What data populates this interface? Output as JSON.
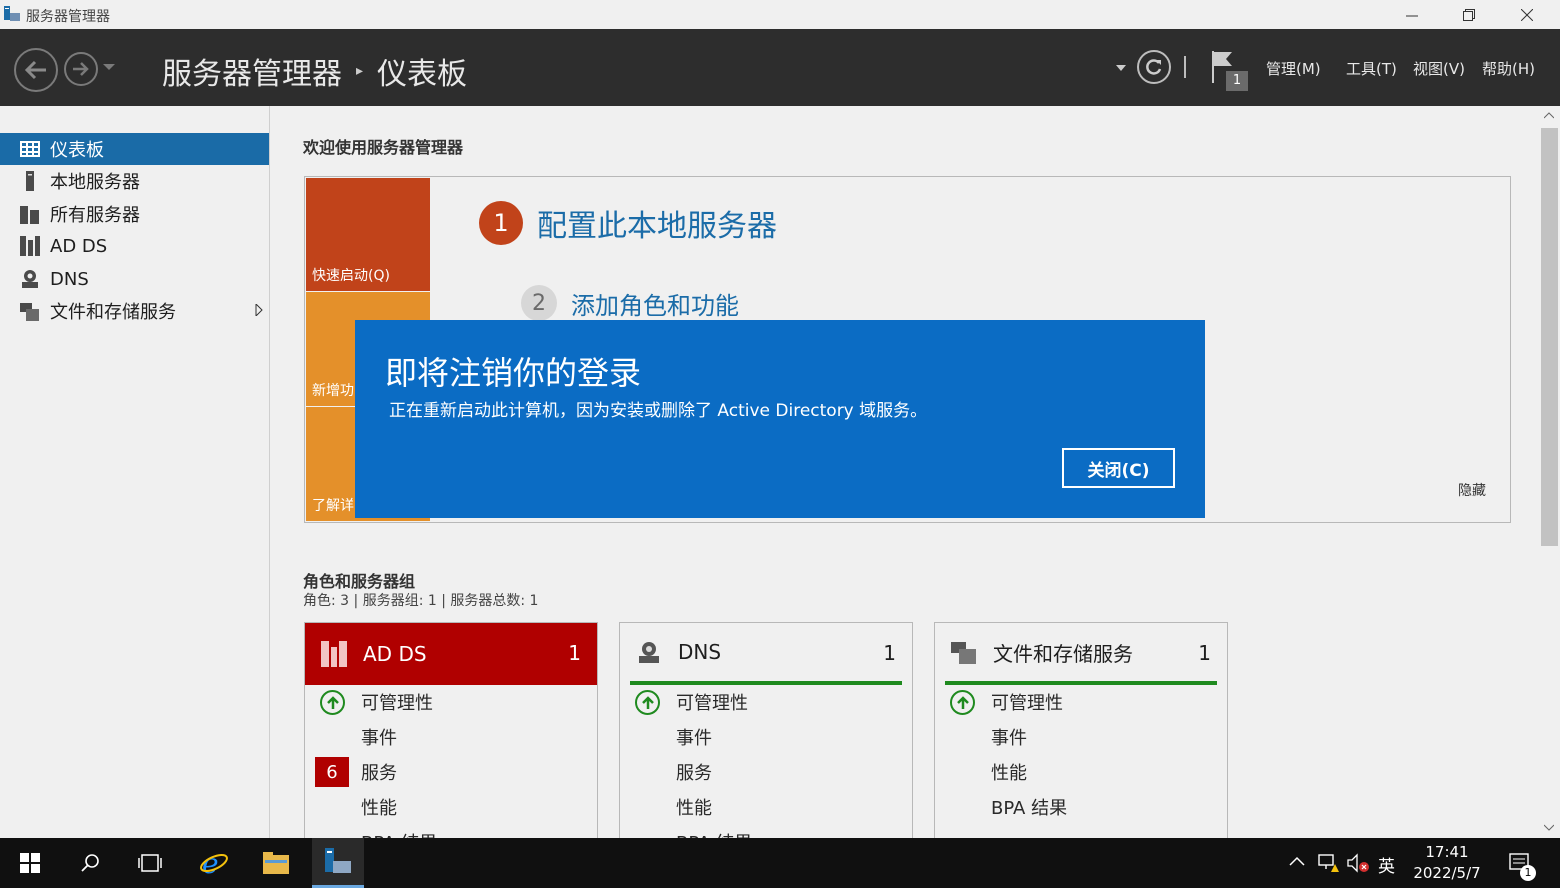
{
  "window": {
    "title": "服务器管理器",
    "controls": [
      "minimize-icon",
      "restore-icon",
      "close-icon"
    ]
  },
  "header": {
    "app_name": "服务器管理器",
    "separator": "▸",
    "current_page": "仪表板",
    "notification_count": "1",
    "menu": [
      "管理(M)",
      "工具(T)",
      "视图(V)",
      "帮助(H)"
    ]
  },
  "sidebar": {
    "items": [
      {
        "label": "仪表板",
        "icon": "dashboard-icon",
        "active": true
      },
      {
        "label": "本地服务器",
        "icon": "server-icon"
      },
      {
        "label": "所有服务器",
        "icon": "servers-icon"
      },
      {
        "label": "AD DS",
        "icon": "adds-icon"
      },
      {
        "label": "DNS",
        "icon": "dns-icon"
      },
      {
        "label": "文件和存储服务",
        "icon": "file-storage-icon",
        "has_submenu": true
      }
    ]
  },
  "welcome": {
    "title": "欢迎使用服务器管理器",
    "tiles": [
      "快速启动(Q)",
      "新增功",
      "了解详"
    ],
    "step1_number": "1",
    "step1_text": "配置此本地服务器",
    "step2_number": "2",
    "step2_text": "添加角色和功能",
    "hide_label": "隐藏"
  },
  "roles": {
    "title": "角色和服务器组",
    "summary": "角色: 3 | 服务器组: 1 | 服务器总数: 1",
    "cards": [
      {
        "name": "AD DS",
        "count": "1",
        "status": "error",
        "rows": [
          "可管理性",
          "事件",
          "服务",
          "性能",
          "BPA 结果"
        ],
        "service_badge": "6"
      },
      {
        "name": "DNS",
        "count": "1",
        "status": "ok",
        "rows": [
          "可管理性",
          "事件",
          "服务",
          "性能",
          "BPA 结果"
        ]
      },
      {
        "name": "文件和存储服务",
        "count": "1",
        "status": "ok",
        "rows": [
          "可管理性",
          "事件",
          "性能",
          "BPA 结果"
        ]
      }
    ]
  },
  "dialog": {
    "title": "即将注销你的登录",
    "message": "正在重新启动此计算机，因为安装或删除了 Active Directory 域服务。",
    "button": "关闭(C)"
  },
  "taskbar": {
    "ime": "英",
    "time": "17:41",
    "date": "2022/5/7",
    "notification_count": "1"
  },
  "colors": {
    "header_bg": "#2d2d2d",
    "accent_blue": "#1a6ba7",
    "dialog_blue": "#0b6cc4",
    "error_red": "#b00000",
    "ok_green": "#1f8a1f",
    "quick_start_orange": "#c1431a",
    "tile_orange": "#e4902a"
  }
}
